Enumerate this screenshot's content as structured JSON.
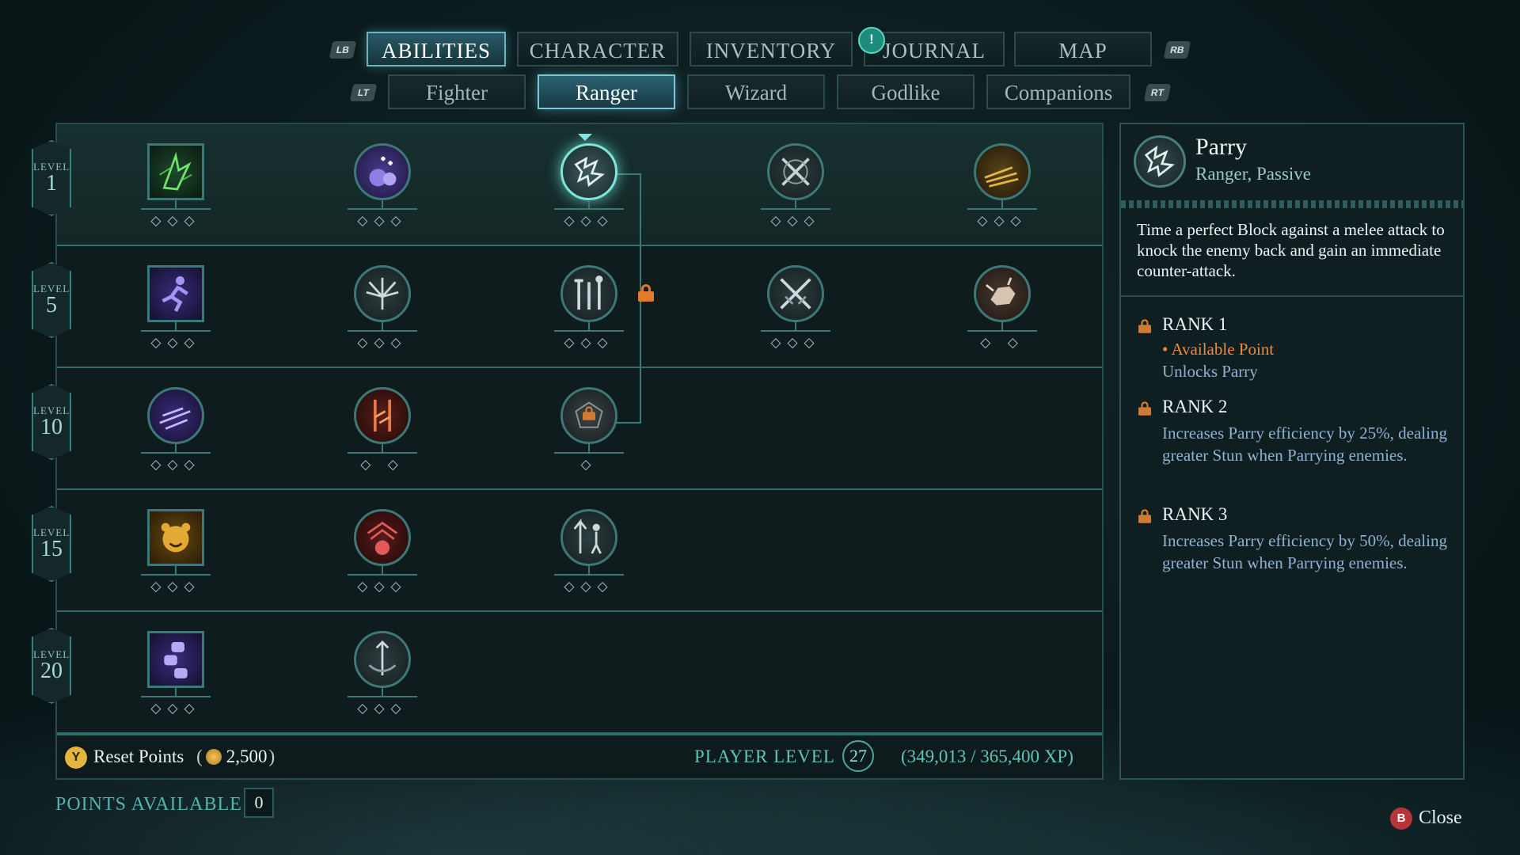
{
  "top_tabs": {
    "lb": "LB",
    "rb": "RB",
    "items": [
      {
        "label": "ABILITIES",
        "active": true
      },
      {
        "label": "CHARACTER",
        "active": false
      },
      {
        "label": "INVENTORY",
        "active": false
      },
      {
        "label": "JOURNAL",
        "active": false
      },
      {
        "label": "MAP",
        "active": false
      }
    ],
    "journal_alert": "!"
  },
  "sub_tabs": {
    "lt": "LT",
    "rt": "RT",
    "items": [
      {
        "label": "Fighter",
        "active": false
      },
      {
        "label": "Ranger",
        "active": true
      },
      {
        "label": "Wizard",
        "active": false
      },
      {
        "label": "Godlike",
        "active": false
      },
      {
        "label": "Companions",
        "active": false
      }
    ]
  },
  "tree": {
    "levels": [
      {
        "word": "LEVEL",
        "num": "1"
      },
      {
        "word": "LEVEL",
        "num": "5"
      },
      {
        "word": "LEVEL",
        "num": "10"
      },
      {
        "word": "LEVEL",
        "num": "15"
      },
      {
        "word": "LEVEL",
        "num": "20"
      }
    ],
    "ranks": {
      "r0": [
        "◇◇◇",
        "◇◇◇",
        "◇◇◇",
        "◇◇◇",
        "◇◇◇"
      ],
      "r1": [
        "◇◇◇",
        "◇◇◇",
        "◇◇◇",
        "◇◇◇",
        "◇ ◇"
      ],
      "r2": [
        "◇◇◇",
        "◇ ◇",
        "◇"
      ],
      "r3": [
        "◇◇◇",
        "◇◇◇",
        "◇◇◇"
      ],
      "r4": [
        "◇◇◇",
        "◇◇◇"
      ]
    },
    "colors": {
      "accent": "#3d7777",
      "selected": "#7fe6de",
      "lock": "#e07b2c"
    }
  },
  "footer": {
    "y_button": "Y",
    "reset_label": "Reset Points",
    "reset_open": "(",
    "reset_cost": "2,500",
    "reset_close": ")",
    "player_level_label": "PLAYER LEVEL",
    "player_level": "27",
    "xp": "(349,013 / 365,400 XP)"
  },
  "points": {
    "label": "POINTS AVAILABLE",
    "value": "0"
  },
  "details": {
    "name": "Parry",
    "subtitle": "Ranger, Passive",
    "description": "Time a perfect Block against a melee attack to knock the enemy back and gain an immediate counter-attack.",
    "ranks": [
      {
        "title": "RANK 1",
        "lines": [
          "• Available Point",
          "Unlocks Parry"
        ]
      },
      {
        "title": "RANK 2",
        "lines": [
          "Increases Parry efficiency by 25%, dealing greater Stun when Parrying enemies."
        ]
      },
      {
        "title": "RANK 3",
        "lines": [
          "Increases Parry efficiency by 50%, dealing greater Stun when Parrying enemies."
        ]
      }
    ]
  },
  "close": {
    "button": "B",
    "label": "Close"
  }
}
